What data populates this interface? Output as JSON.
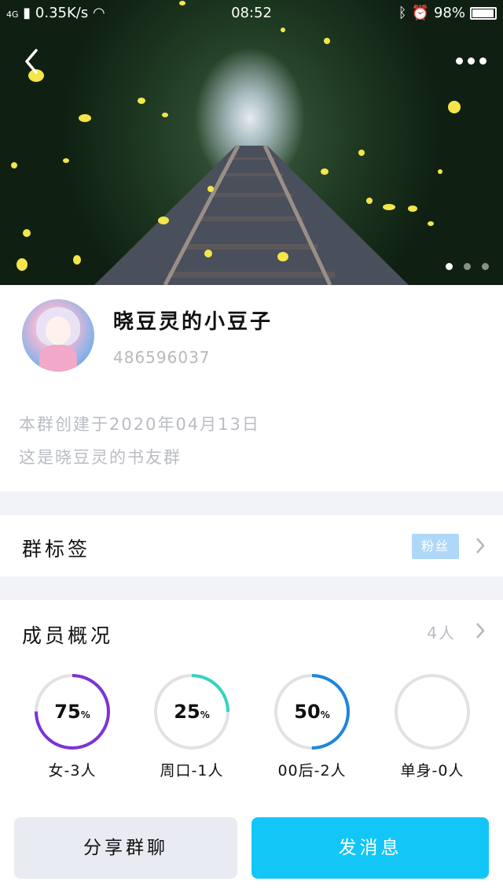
{
  "status_bar": {
    "network": "4G",
    "speed": "0.35K/s",
    "time": "08:52",
    "battery": "98%"
  },
  "hero": {
    "icons": [
      "back-icon",
      "more-icon"
    ],
    "page_indicator": {
      "count": 3,
      "active": 0
    }
  },
  "profile": {
    "group_name": "晓豆灵的小豆子",
    "group_id": "486596037",
    "created_text": "本群创建于2020年04月13日",
    "description": "这是晓豆灵的书友群"
  },
  "tags_row": {
    "title": "群标签",
    "tag": "粉丝"
  },
  "members_row": {
    "title": "成员概况",
    "count": "4人"
  },
  "stats": [
    {
      "percent_text": "75",
      "unit": "%",
      "value": 0.75,
      "label": "女-3人",
      "color": "#7b34d8"
    },
    {
      "percent_text": "25",
      "unit": "%",
      "value": 0.25,
      "label": "周口-1人",
      "color": "#34d4c0"
    },
    {
      "percent_text": "50",
      "unit": "%",
      "value": 0.5,
      "label": "00后-2人",
      "color": "#1c86e0"
    },
    {
      "percent_text": "",
      "unit": "",
      "value": 0,
      "label": "单身-0人",
      "color": "#e2e2e4"
    }
  ],
  "buttons": {
    "share": "分享群聊",
    "send": "发消息"
  }
}
